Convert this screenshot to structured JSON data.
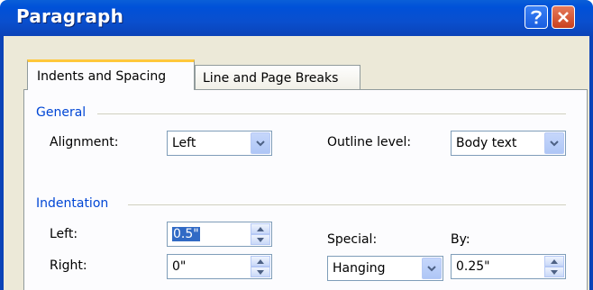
{
  "window": {
    "title": "Paragraph"
  },
  "titlebar": {
    "help_icon": "question-mark",
    "close_icon": "x-mark"
  },
  "tabs": [
    {
      "label": "Indents and Spacing",
      "active": true
    },
    {
      "label": "Line and Page Breaks",
      "active": false
    }
  ],
  "general": {
    "heading": "General",
    "alignment_label": "Alignment:",
    "alignment_value": "Left",
    "outline_label": "Outline level:",
    "outline_value": "Body text"
  },
  "indentation": {
    "heading": "Indentation",
    "left_label": "Left:",
    "left_value": "0.5\"",
    "right_label": "Right:",
    "right_value": "0\"",
    "special_label": "Special:",
    "special_value": "Hanging",
    "by_label": "By:",
    "by_value": "0.25\""
  },
  "colors": {
    "titlebar": "#0a4fce",
    "section_heading": "#0046d5",
    "dialog_bg": "#ece9d8",
    "active_tab_border": "#ffc83c"
  }
}
